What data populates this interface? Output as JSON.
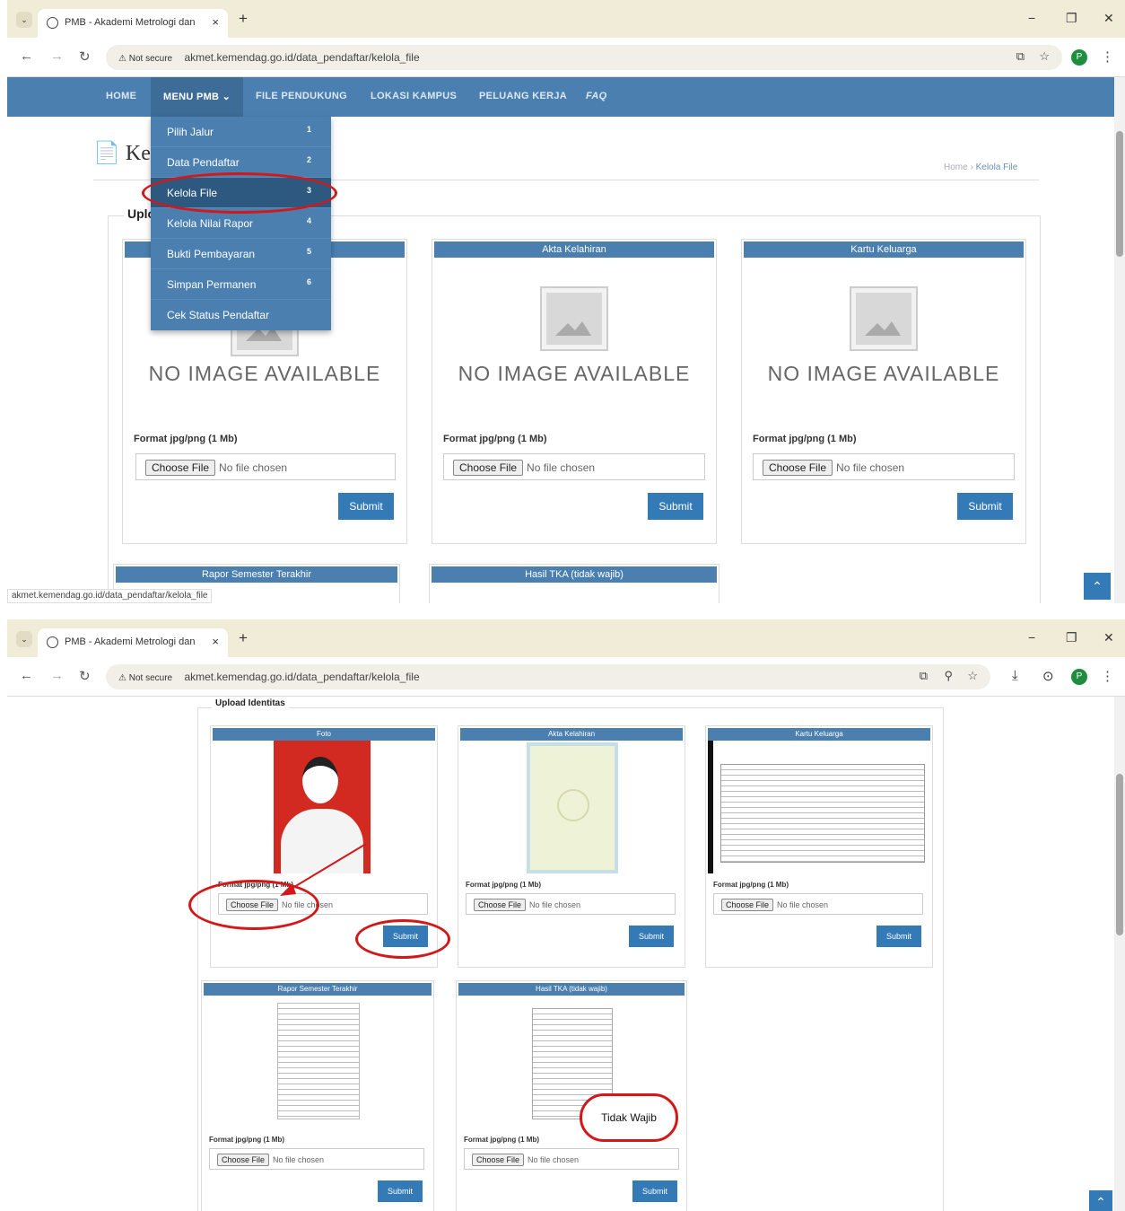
{
  "browser": {
    "tab_title": "PMB - Akademi Metrologi dan",
    "tab_close": "×",
    "new_tab": "+",
    "tab_dropdown": "⌄",
    "security": "Not secure",
    "url": "akmet.kemendag.go.id/data_pendaftar/kelola_file",
    "profile_initial": "P",
    "minimize": "−",
    "restore": "❐",
    "close": "✕"
  },
  "nav": {
    "items": [
      "HOME",
      "MENU PMB ⌄",
      "FILE PENDUKUNG",
      "LOKASI KAMPUS",
      "PELUANG KERJA",
      "FAQ"
    ]
  },
  "dropdown": {
    "items": [
      {
        "label": "Pilih Jalur",
        "badge": "1"
      },
      {
        "label": "Data Pendaftar",
        "badge": "2"
      },
      {
        "label": "Kelola File",
        "badge": "3"
      },
      {
        "label": "Kelola Nilai Rapor",
        "badge": "4"
      },
      {
        "label": "Bukti Pembayaran",
        "badge": "5"
      },
      {
        "label": "Simpan Permanen",
        "badge": "6"
      },
      {
        "label": "Cek Status Pendaftar",
        "badge": ""
      }
    ]
  },
  "page": {
    "title_visible": "Kel",
    "breadcrumb_home": "Home",
    "breadcrumb_sep": "›",
    "breadcrumb_current": "Kelola File",
    "legend_partial": "Uplo",
    "legend_full": "Upload Identitas",
    "no_image": "NO IMAGE AVAILABLE",
    "format": "Format jpg/png (1 Mb)",
    "choose_file": "Choose File",
    "no_file": "No file chosen",
    "submit": "Submit",
    "scroll_top": "⌃"
  },
  "cards": {
    "foto": "Foto",
    "akta": "Akta Kelahiran",
    "kk": "Kartu Keluarga",
    "rapor": "Rapor Semester Terakhir",
    "tka": "Hasil TKA (tidak wajib)"
  },
  "status_url": "akmet.kemendag.go.id/data_pendaftar/kelola_file",
  "annotation": {
    "tidak_wajib": "Tidak Wajib"
  },
  "colors": {
    "nav": "#4a7fb0",
    "submit": "#337ab7",
    "highlight": "#d21818"
  }
}
